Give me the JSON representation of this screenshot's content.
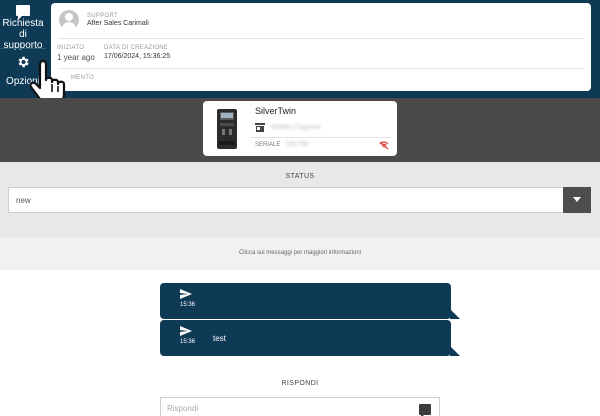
{
  "sidebar": {
    "request_label": "Richiesta di supporto",
    "options_label": "Opzioni"
  },
  "ticket": {
    "support_label": "SUPPORT",
    "support_value": "After Sales Carimali",
    "started_label": "INIZIATO",
    "started_value": "1 year ago",
    "created_label": "DATA DI CREAZIONE",
    "created_value": "17/06/2024, 15:36:25",
    "attachment_label": "MENTO"
  },
  "machine": {
    "name": "SilverTwin",
    "owner": "Matteo Cagnoni",
    "serial_label": "SERIALE",
    "serial_value": "230799"
  },
  "status": {
    "title": "STATUS",
    "value": "new",
    "info": "Clicca sui messaggi per maggiori informazioni"
  },
  "messages": [
    {
      "time": "15:36",
      "text": ""
    },
    {
      "time": "15:36",
      "text": "test"
    }
  ],
  "reply": {
    "title": "RISPONDI",
    "placeholder": "Rispondi"
  },
  "colors": {
    "primary": "#0e3a56",
    "band_grey": "#4a4a4a",
    "status_bg": "#e8e8e8",
    "alert_red": "#e0413b"
  }
}
